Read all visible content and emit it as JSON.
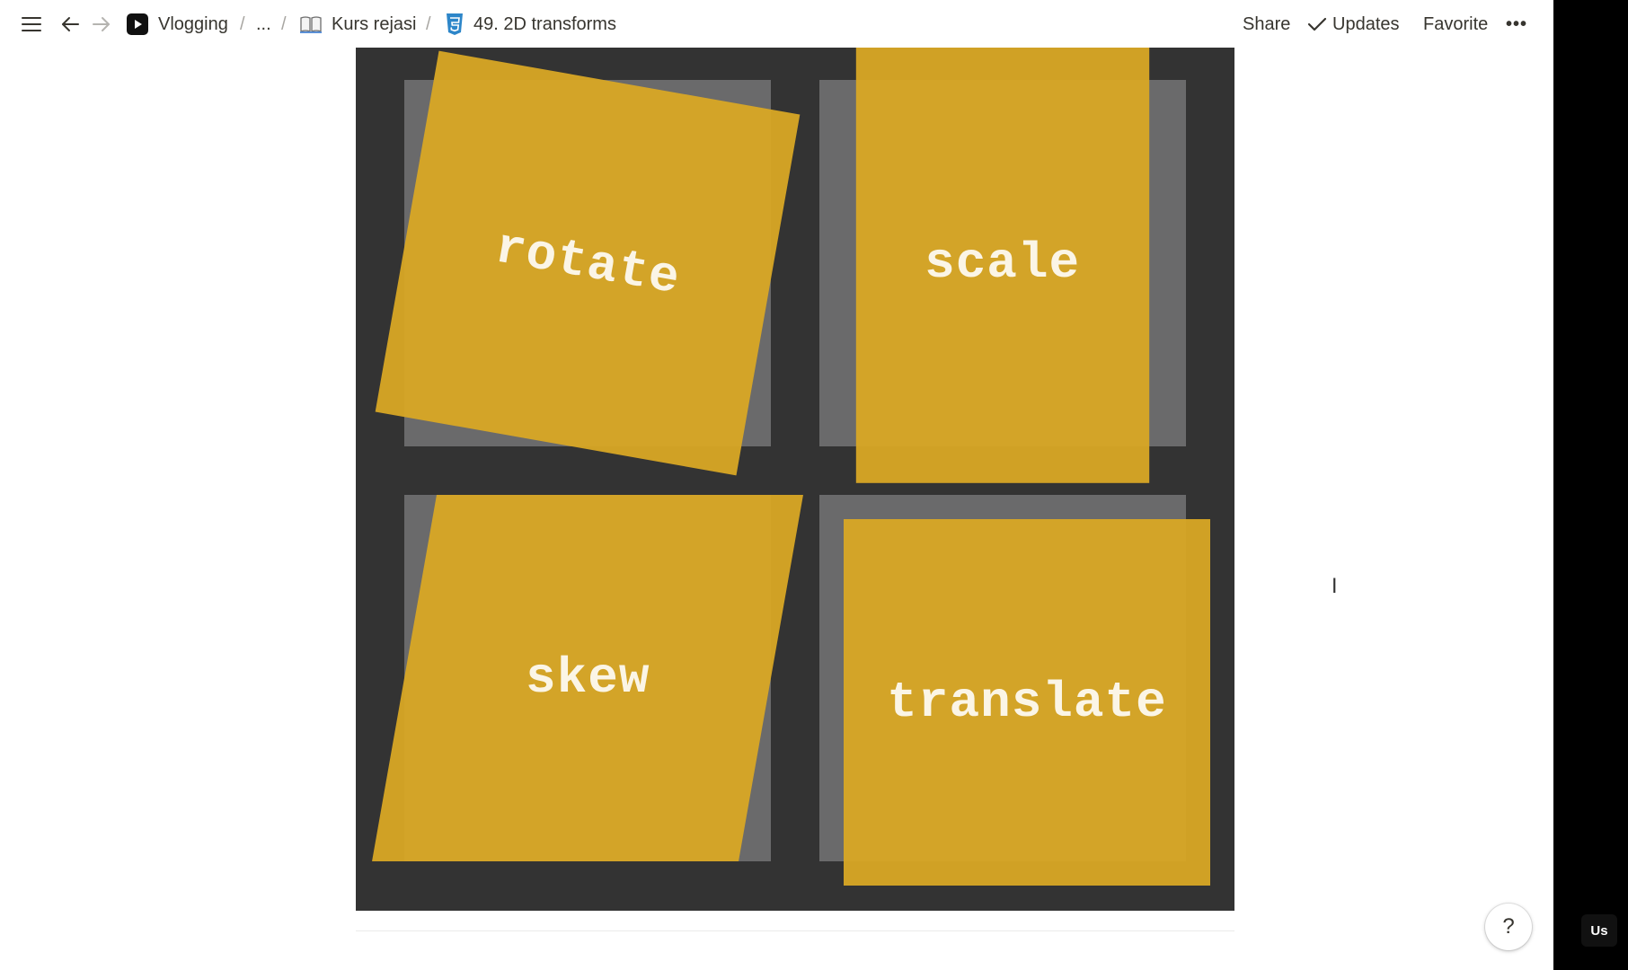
{
  "topbar": {
    "breadcrumbs": [
      {
        "label": "Vlogging",
        "icon": "youtube-icon"
      },
      {
        "label": "...",
        "icon": ""
      },
      {
        "label": "Kurs rejasi",
        "icon": "open-book-icon"
      },
      {
        "label": "49. 2D transforms",
        "icon": "css3-icon"
      }
    ],
    "separator": "/",
    "share_label": "Share",
    "updates_label": "Updates",
    "favorite_label": "Favorite",
    "more_label": "•••"
  },
  "figure": {
    "cards": [
      {
        "label": "rotate"
      },
      {
        "label": "scale"
      },
      {
        "label": "skew"
      },
      {
        "label": "translate"
      }
    ]
  },
  "help_label": "?",
  "corner_badge": "Us",
  "colors": {
    "card": "#daa824",
    "ghost": "#6a6a6b",
    "figure_bg": "#333333",
    "text": "#37352f"
  }
}
